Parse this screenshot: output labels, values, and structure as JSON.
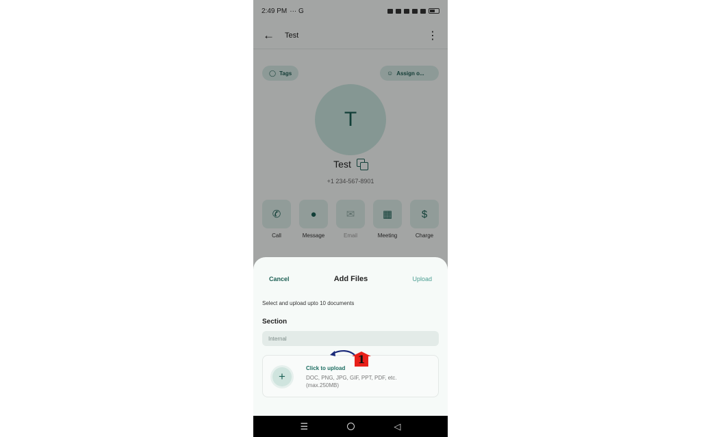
{
  "status_bar": {
    "time": "2:49 PM",
    "extra": "··· G"
  },
  "app_bar": {
    "title": "Test"
  },
  "chips": {
    "tags": "Tags",
    "assign": "Assign o..."
  },
  "contact": {
    "initial": "T",
    "name": "Test",
    "phone": "+1 234-567-8901"
  },
  "actions": [
    {
      "label": "Call",
      "icon": "phone-icon"
    },
    {
      "label": "Message",
      "icon": "chat-icon"
    },
    {
      "label": "Email",
      "icon": "mail-icon"
    },
    {
      "label": "Meeting",
      "icon": "calendar-icon"
    },
    {
      "label": "Charge",
      "icon": "dollar-icon"
    }
  ],
  "sheet": {
    "cancel": "Cancel",
    "title": "Add Files",
    "upload": "Upload",
    "description": "Select and upload upto 10 documents",
    "section_label": "Section",
    "section_value": "Internal",
    "upload_cta": "Click to upload",
    "upload_hint": "DOC, PNG, JPG, GIF, PPT, PDF, etc. (max.250MB)"
  },
  "annotation": {
    "number": "1"
  },
  "colors": {
    "accent": "#1c5f54",
    "accent_light": "#d3e6e1",
    "marker": "#e8201a",
    "arrow": "#1a2a7a"
  }
}
